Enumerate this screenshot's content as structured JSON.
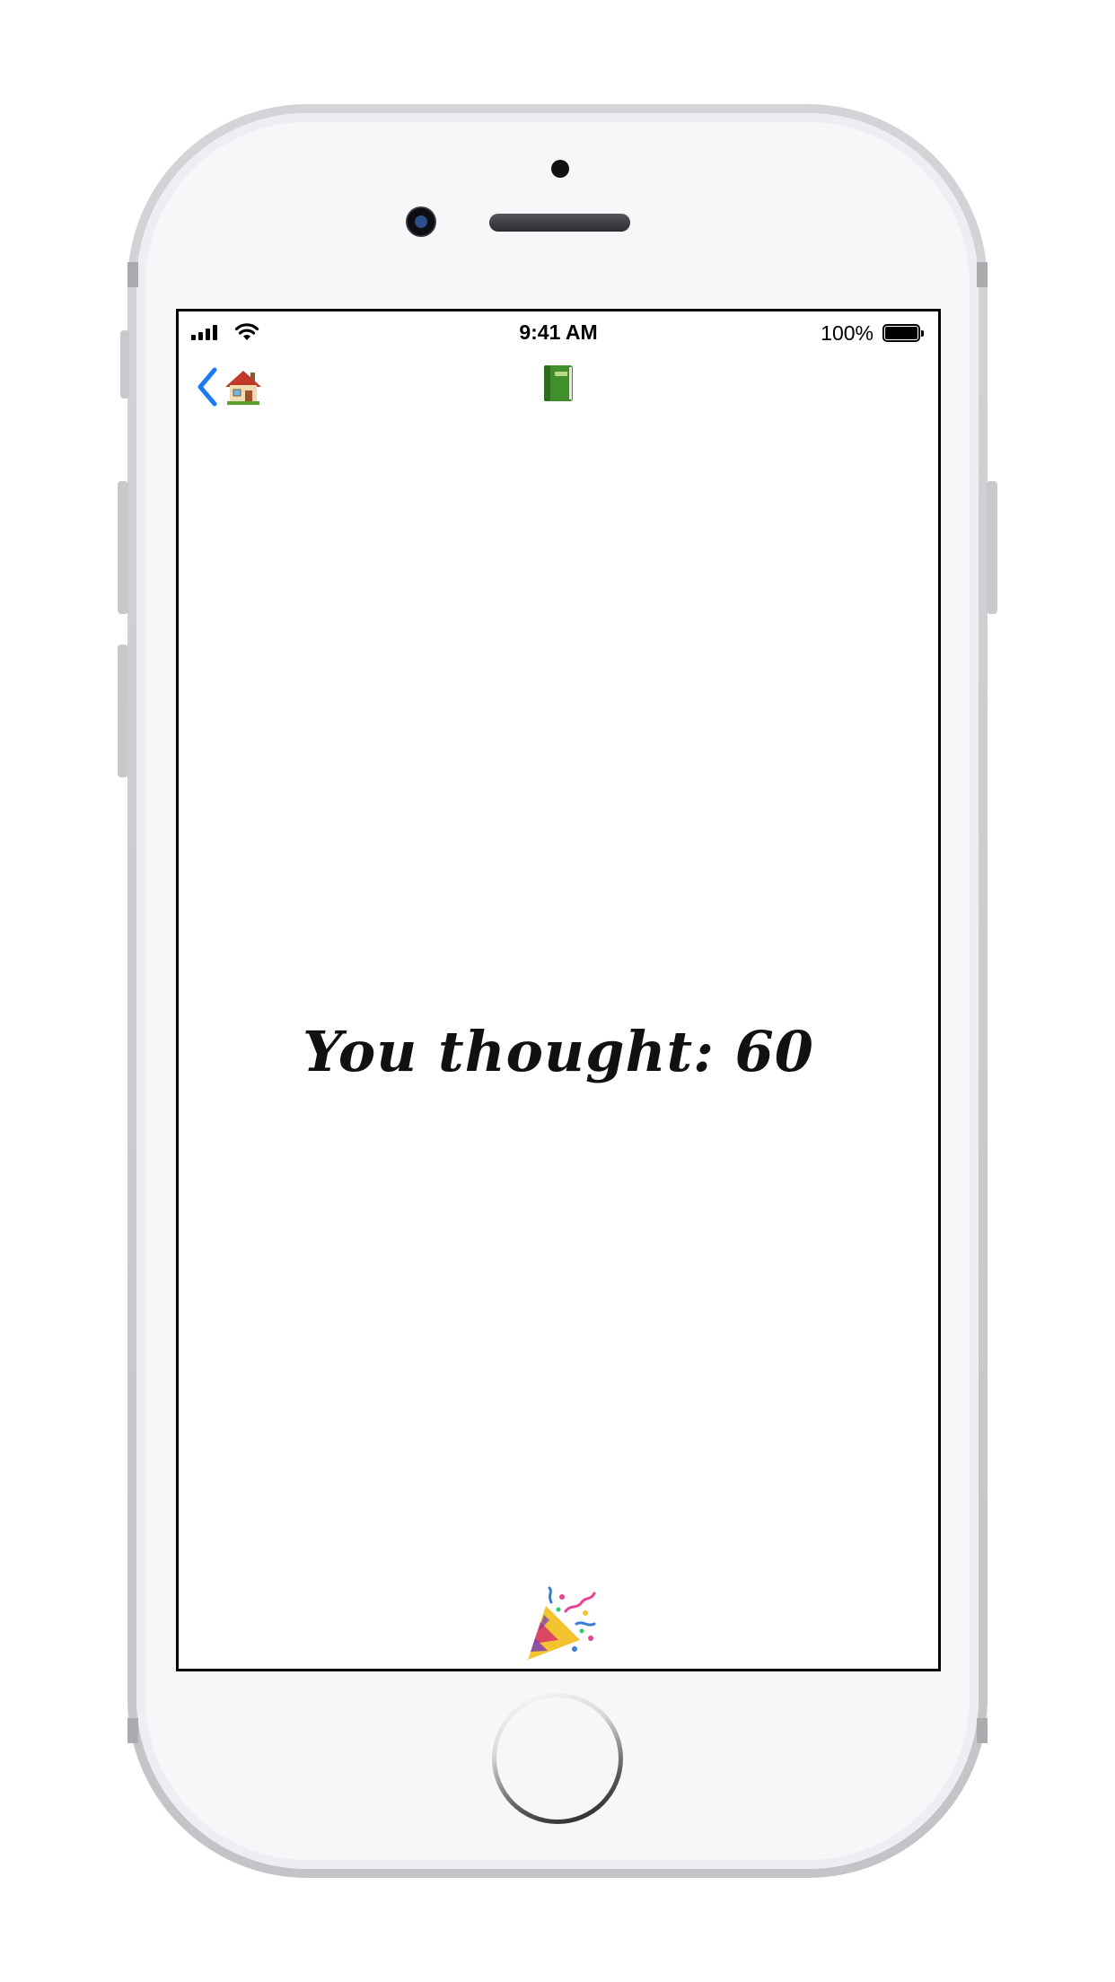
{
  "status_bar": {
    "time": "9:41 AM",
    "battery_percent": "100%",
    "signal_bars": 4,
    "wifi": true,
    "battery_level": 1.0
  },
  "nav_bar": {
    "back_icon": "chevron-left-icon",
    "back_target_icon": "house-icon",
    "title_icon": "green-book-icon",
    "accent_color": "#1a7cf5"
  },
  "main": {
    "result_text": "You thought: 60",
    "celebration_icon": "party-popper-icon"
  }
}
